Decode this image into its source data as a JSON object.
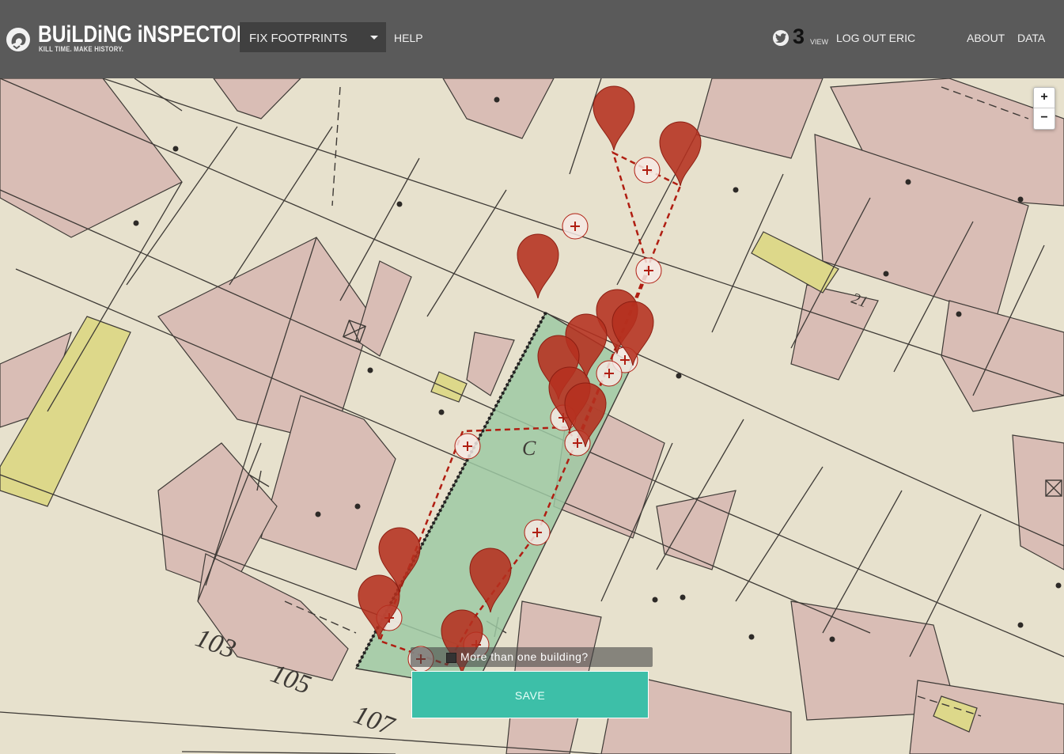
{
  "header": {
    "logo_icon": "lion-head-icon",
    "title": "BUiLDiNG iNSPECTOR",
    "tagline": "KILL TIME. MAKE HISTORY.",
    "task_select": "FIX FOOTPRINTS",
    "help": "HELP",
    "twitter_icon": "twitter-bird-icon",
    "score": "3",
    "view": "VIEW",
    "logout": "LOG OUT ERIC",
    "about": "ABOUT",
    "data": "DATA"
  },
  "map": {
    "zoom_in": "+",
    "zoom_out": "−",
    "street_numbers": [
      "103",
      "105",
      "107"
    ],
    "lot_letter": "C",
    "lot_number": "21"
  },
  "controls": {
    "multi_building_label": "More than one building?",
    "save_label": "SAVE"
  },
  "colors": {
    "header": "#5a5a5a",
    "marker": "#b5301f",
    "footprint_fill": "#9ec9a3",
    "save": "#3dbfa8"
  }
}
